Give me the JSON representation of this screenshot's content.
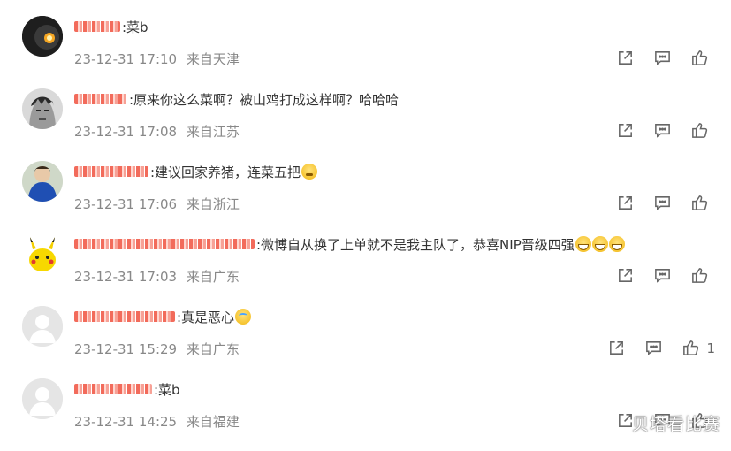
{
  "comments": [
    {
      "username": "",
      "text": ":菜b",
      "date": "23-12-31 17:10",
      "location": "来自天津",
      "likes": "",
      "avatar": "avatar-dark-fire",
      "emojis": []
    },
    {
      "username": "",
      "text": ":原来你这么菜啊？被山鸡打成这样啊？哈哈哈",
      "date": "23-12-31 17:08",
      "location": "来自江苏",
      "likes": "",
      "avatar": "avatar-sketch-face",
      "emojis": []
    },
    {
      "username": "",
      "text": ":建议回家养猪，连菜五把",
      "date": "23-12-31 17:06",
      "location": "来自浙江",
      "likes": "",
      "avatar": "avatar-blue-character",
      "emojis": [
        "sweat"
      ]
    },
    {
      "username": "",
      "text": ":微博自从换了上单就不是我主队了，恭喜NIP晋级四强",
      "date": "23-12-31 17:03",
      "location": "来自广东",
      "likes": "",
      "avatar": "avatar-pikachu",
      "emojis": [
        "grin",
        "grin",
        "grin"
      ]
    },
    {
      "username": "",
      "text": ":真是恶心",
      "date": "23-12-31 15:29",
      "location": "来自广东",
      "likes": "1",
      "avatar": "avatar-default",
      "emojis": [
        "cry"
      ]
    },
    {
      "username": "",
      "text": ":菜b",
      "date": "23-12-31 14:25",
      "location": "来自福建",
      "likes": "",
      "avatar": "avatar-default",
      "emojis": []
    }
  ],
  "icons": {
    "share": "share-icon",
    "comment": "comment-icon",
    "like": "thumbs-up-icon"
  },
  "watermark": "贝塔看比赛",
  "colors": {
    "text": "#333333",
    "meta": "#888888",
    "icon": "#666666",
    "redacted_name": "#f26b5b"
  }
}
